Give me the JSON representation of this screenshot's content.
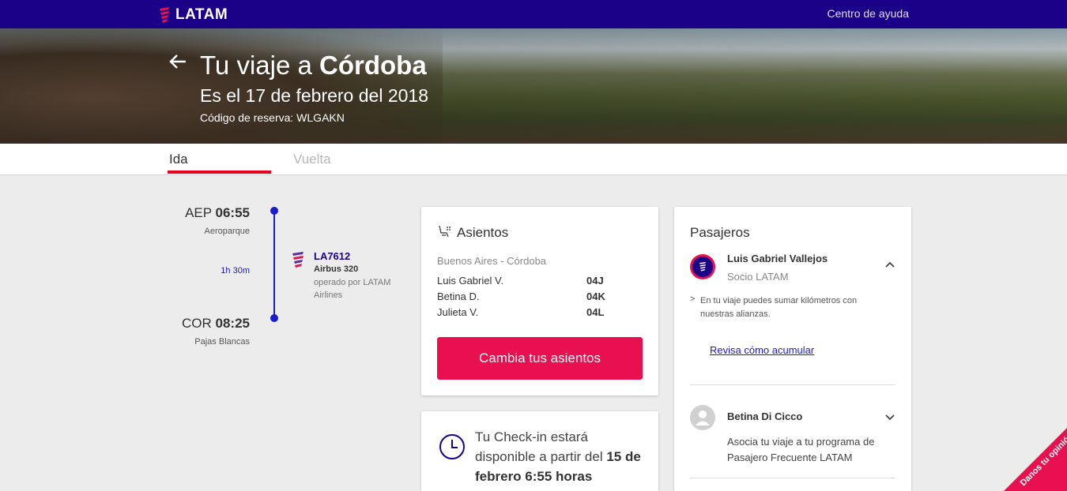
{
  "header": {
    "brand": "LATAM",
    "help_link": "Centro de ayuda"
  },
  "hero": {
    "title_prefix": "Tu viaje a ",
    "title_city": "Córdoba",
    "date": "Es el 17 de febrero del 2018",
    "booking_code": "Código de reserva: WLGAKN"
  },
  "tabs": {
    "ida": "Ida",
    "vuelta": "Vuelta"
  },
  "flight": {
    "departure_code": "AEP",
    "departure_time": "06:55",
    "departure_airport": "Aeroparque",
    "duration": "1h 30m",
    "arrival_code": "COR",
    "arrival_time": "08:25",
    "arrival_airport": "Pajas Blancas",
    "flight_number": "LA7612",
    "aircraft": "Airbus 320",
    "operated_by": "operado por LATAM Airlines"
  },
  "seats": {
    "title": "Asientos",
    "route": "Buenos Aires - Córdoba",
    "rows": [
      {
        "name": "Luis Gabriel V.",
        "seat": "04J"
      },
      {
        "name": "Betina D.",
        "seat": "04K"
      },
      {
        "name": "Julieta V.",
        "seat": "04L"
      }
    ],
    "button": "Cambia tus asientos"
  },
  "checkin": {
    "text_plain": "Tu Check-in estará disponible a partir del ",
    "text_bold": "15 de febrero 6:55 horas"
  },
  "passengers": {
    "title": "Pasajeros",
    "p1_name": "Luis Gabriel Vallejos",
    "p1_tier": "Socio LATAM",
    "p1_note_mark": ">",
    "p1_note": "En tu viaje puedes sumar kilómetros con nuestras alianzas.",
    "p1_link": "Revisa cómo acumular",
    "p2_name": "Betina Di Cicco",
    "p2_info": "Asocia tu viaje a tu programa de Pasajero Frecuente LATAM"
  },
  "feedback": {
    "label": "Danos tu opinión"
  },
  "colors": {
    "brand_navy": "#1b0088",
    "accent_pink": "#e8104e",
    "timeline_blue": "#1b1bcf",
    "tab_underline": "#e8001f"
  },
  "icons": {
    "back": "arrow-left-icon",
    "seat": "seat-icon",
    "clock": "clock-icon",
    "chevron_up": "chevron-up-icon",
    "chevron_down": "chevron-down-icon"
  }
}
